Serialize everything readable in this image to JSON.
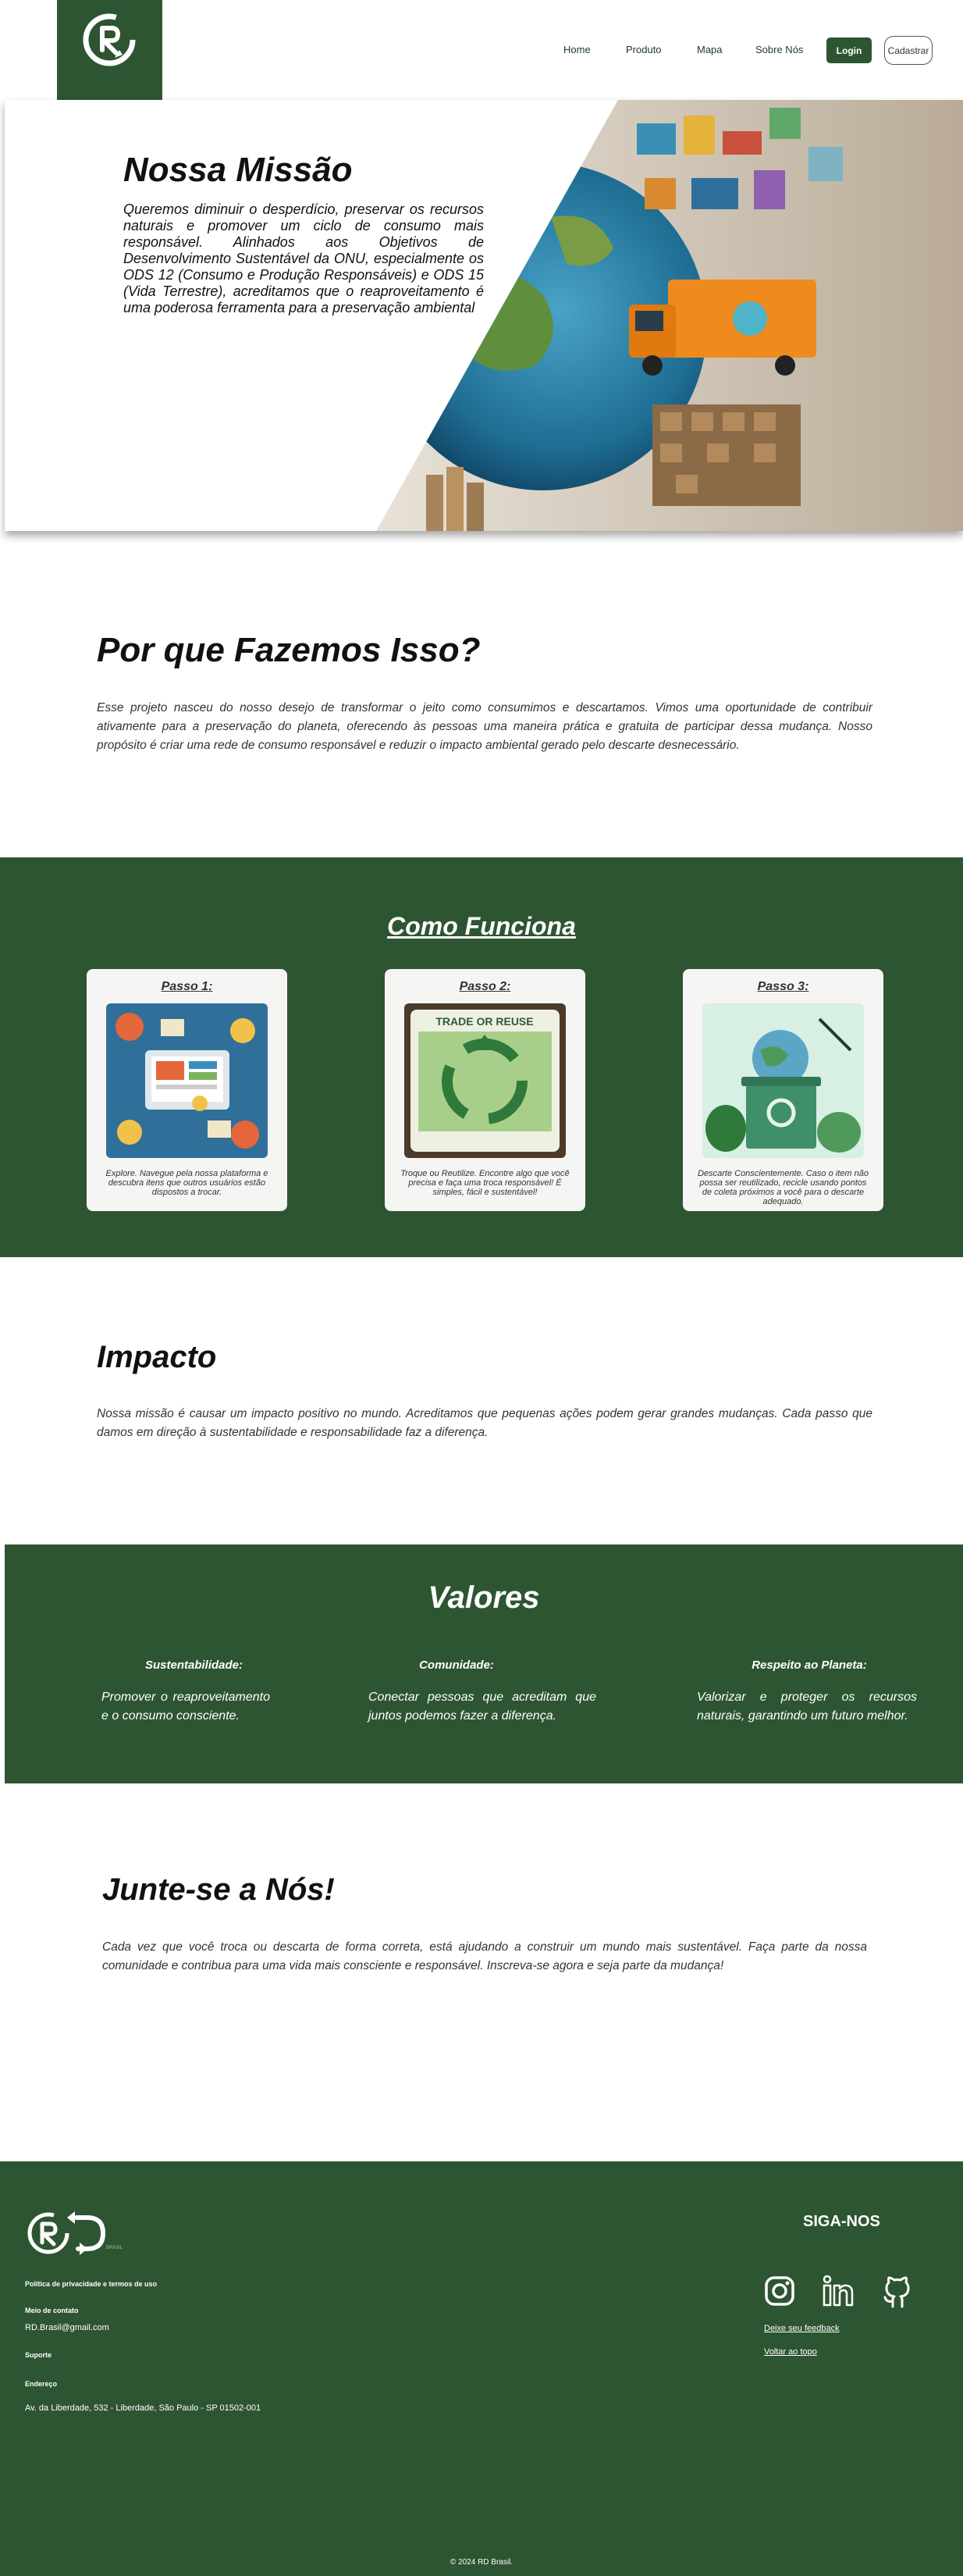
{
  "nav": {
    "items": [
      "Home",
      "Produto",
      "Mapa",
      "Sobre Nós"
    ],
    "login": "Login",
    "signup": "Cadastrar"
  },
  "hero": {
    "title": "Nossa Missão",
    "text": "Queremos diminuir o desperdício, preservar os recursos naturais e promover um ciclo de consumo mais responsável. Alinhados aos Objetivos de Desenvolvimento Sustentável da ONU, especialmente os ODS 12 (Consumo e Produção Responsáveis) e ODS 15 (Vida Terrestre), acreditamos que o reaproveitamento é uma poderosa ferramenta para a preservação ambiental"
  },
  "why": {
    "title": "Por que Fazemos Isso?",
    "text": "Esse projeto nasceu do nosso desejo de transformar o jeito como consumimos e descartamos. Vimos uma oportunidade de contribuir ativamente para a preservação do planeta, oferecendo às pessoas uma maneira prática e gratuita de participar dessa mudança. Nosso propósito é criar uma rede de consumo responsável e reduzir o impacto ambiental gerado pelo descarte desnecessário."
  },
  "how": {
    "title": "Como Funciona",
    "steps": [
      {
        "title": "Passo 1:",
        "text": "Explore. Navegue pela nossa plataforma e descubra itens que outros usuários estão dispostos a trocar."
      },
      {
        "title": "Passo 2:",
        "text": "Troque ou Reutilize. Encontre algo que você precisa e faça uma troca responsável! É simples, fácil e sustentável!",
        "image_text": "TRADE OR REUSE"
      },
      {
        "title": "Passo 3:",
        "text": "Descarte Conscientemente. Caso o item não possa ser reutilizado, recicle usando pontos de coleta próximos a você para o descarte adequado."
      }
    ]
  },
  "impact": {
    "title": "Impacto",
    "text": "Nossa missão é causar um impacto positivo no mundo. Acreditamos que pequenas ações podem gerar grandes mudanças. Cada passo que damos em direção à sustentabilidade e responsabilidade faz a diferença."
  },
  "values": {
    "title": "Valores",
    "items": [
      {
        "title": "Sustentabilidade:",
        "text": "Promover o reaproveitamento e o consumo consciente."
      },
      {
        "title": "Comunidade:",
        "text": "Conectar pessoas que acreditam que juntos podemos fazer a diferença."
      },
      {
        "title": "Respeito ao Planeta:",
        "text": "Valorizar e proteger os recursos naturais, garantindo um futuro melhor."
      }
    ]
  },
  "join": {
    "title": "Junte-se a Nós!",
    "text": "Cada vez que você troca ou descarta de forma correta, está ajudando a construir um mundo mais sustentável. Faça parte da nossa comunidade e contribua para uma vida mais consciente e responsável. Inscreva-se agora e seja parte da mudança!"
  },
  "footer": {
    "logo_tagline": "BRASIL",
    "privacy": "Política de privacidade e termos de uso",
    "contact_label": "Meio de contato",
    "contact_value": "RD.Brasil@gmail.com",
    "support_label": "Suporte",
    "address_label": "Endereço",
    "address_value": "Av. da Liberdade, 532 - Liberdade, São Paulo - SP 01502-001",
    "follow": "SIGA-NOS",
    "feedback": "Deixe seu feedback",
    "back_to_top": "Voltar ao topo",
    "copyright": "© 2024 RD Brasil."
  },
  "colors": {
    "brand_green": "#2e5532",
    "card_bg": "#f5f5f3"
  },
  "icons": [
    "recycle-logo-icon",
    "instagram-icon",
    "linkedin-icon",
    "github-icon"
  ]
}
